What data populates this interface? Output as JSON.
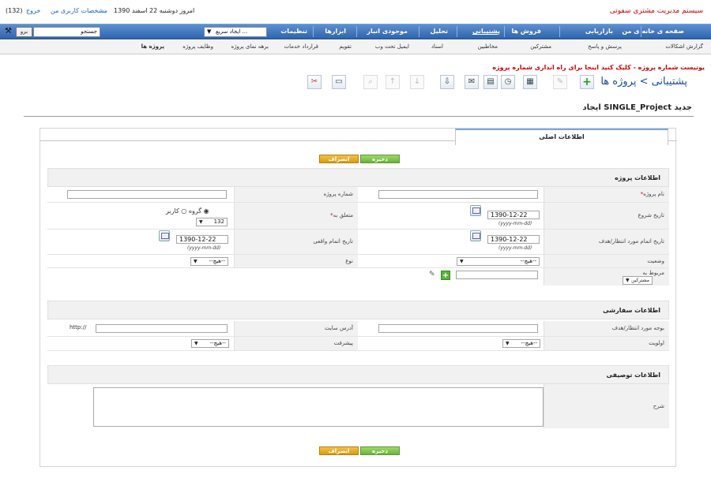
{
  "header": {
    "app_name": "سیستم مدیریت مشتری سفوتی",
    "date": "امروز دوشنبه 22 اسفند 1390",
    "user_link": "مشخصات کاربری من",
    "exit_link": "خروج",
    "count": "(132)"
  },
  "nav": {
    "items": [
      "صفحه ی خانه ی من",
      "بازاریابی",
      "فروش ها",
      "پشتیبانی",
      "تحلیل",
      "موجودی انبار",
      "ابزارها",
      "تنظیمات"
    ],
    "quick_create": "ایجاد سریع ...",
    "search_placeholder": "جستجو",
    "go_label": "برو"
  },
  "subnav": [
    "گزارش اشکالات",
    "پرسش و پاسخ",
    "مشترکین",
    "مخاطبین",
    "اسناد",
    "ایمیل تحت وب",
    "تقویم",
    "قرارداد خدمات",
    "برهه نمای پروژه",
    "وظایف پروژه",
    "پروژه ها"
  ],
  "notice": "یوتیست شماره پروژه - کلیک کنید اینجا برای راه اندازی شماره پروژه",
  "breadcrumb": "پشتیبانی > پروژه ها",
  "toolbar_icons": [
    "add-icon",
    "edit-icon",
    "calendar-icon",
    "clock-icon",
    "calculator-icon",
    "chat-icon",
    "export-icon",
    "sort-down-icon",
    "sort-up-icon",
    "search-icon",
    "monitor-icon",
    "tools-icon"
  ],
  "page_title": "ایجاد SINGLE_Project جدید",
  "tab_main": "اطلاعات اصلی",
  "buttons": {
    "save": "ذخیره",
    "cancel": "انصراف"
  },
  "sections": {
    "project": "اطلاعات پروژه",
    "custom": "اطلاعات سفارشی",
    "description": "اطلاعات توصیفی"
  },
  "labels": {
    "project_name": "نام پروژه",
    "project_number": "شماره پروژه",
    "start_date": "تاریخ شروع",
    "assigned_to": "متعلق به",
    "target_end": "تاریخ اتمام مورد انتظار/هدف",
    "actual_end": "تاریخ اتمام واقعی",
    "status": "وضعیت",
    "type": "نوع",
    "related_to": "مربوط به",
    "target_budget": "بوجه مورد انتظار/هدف",
    "website": "آدرس سایت",
    "priority": "اولویت",
    "progress": "پیشرفت",
    "description": "شرح"
  },
  "values": {
    "start_date": "1390-12-22",
    "target_end": "1390-12-22",
    "actual_end": "1390-12-22",
    "date_hint": "(yyyy-mm-dd)",
    "user_radio": "کاربر",
    "group_radio": "گروه",
    "user_id": "132",
    "none_option": "--هیچ--",
    "related_type": "مشترکین",
    "website_prefix": "http://"
  }
}
